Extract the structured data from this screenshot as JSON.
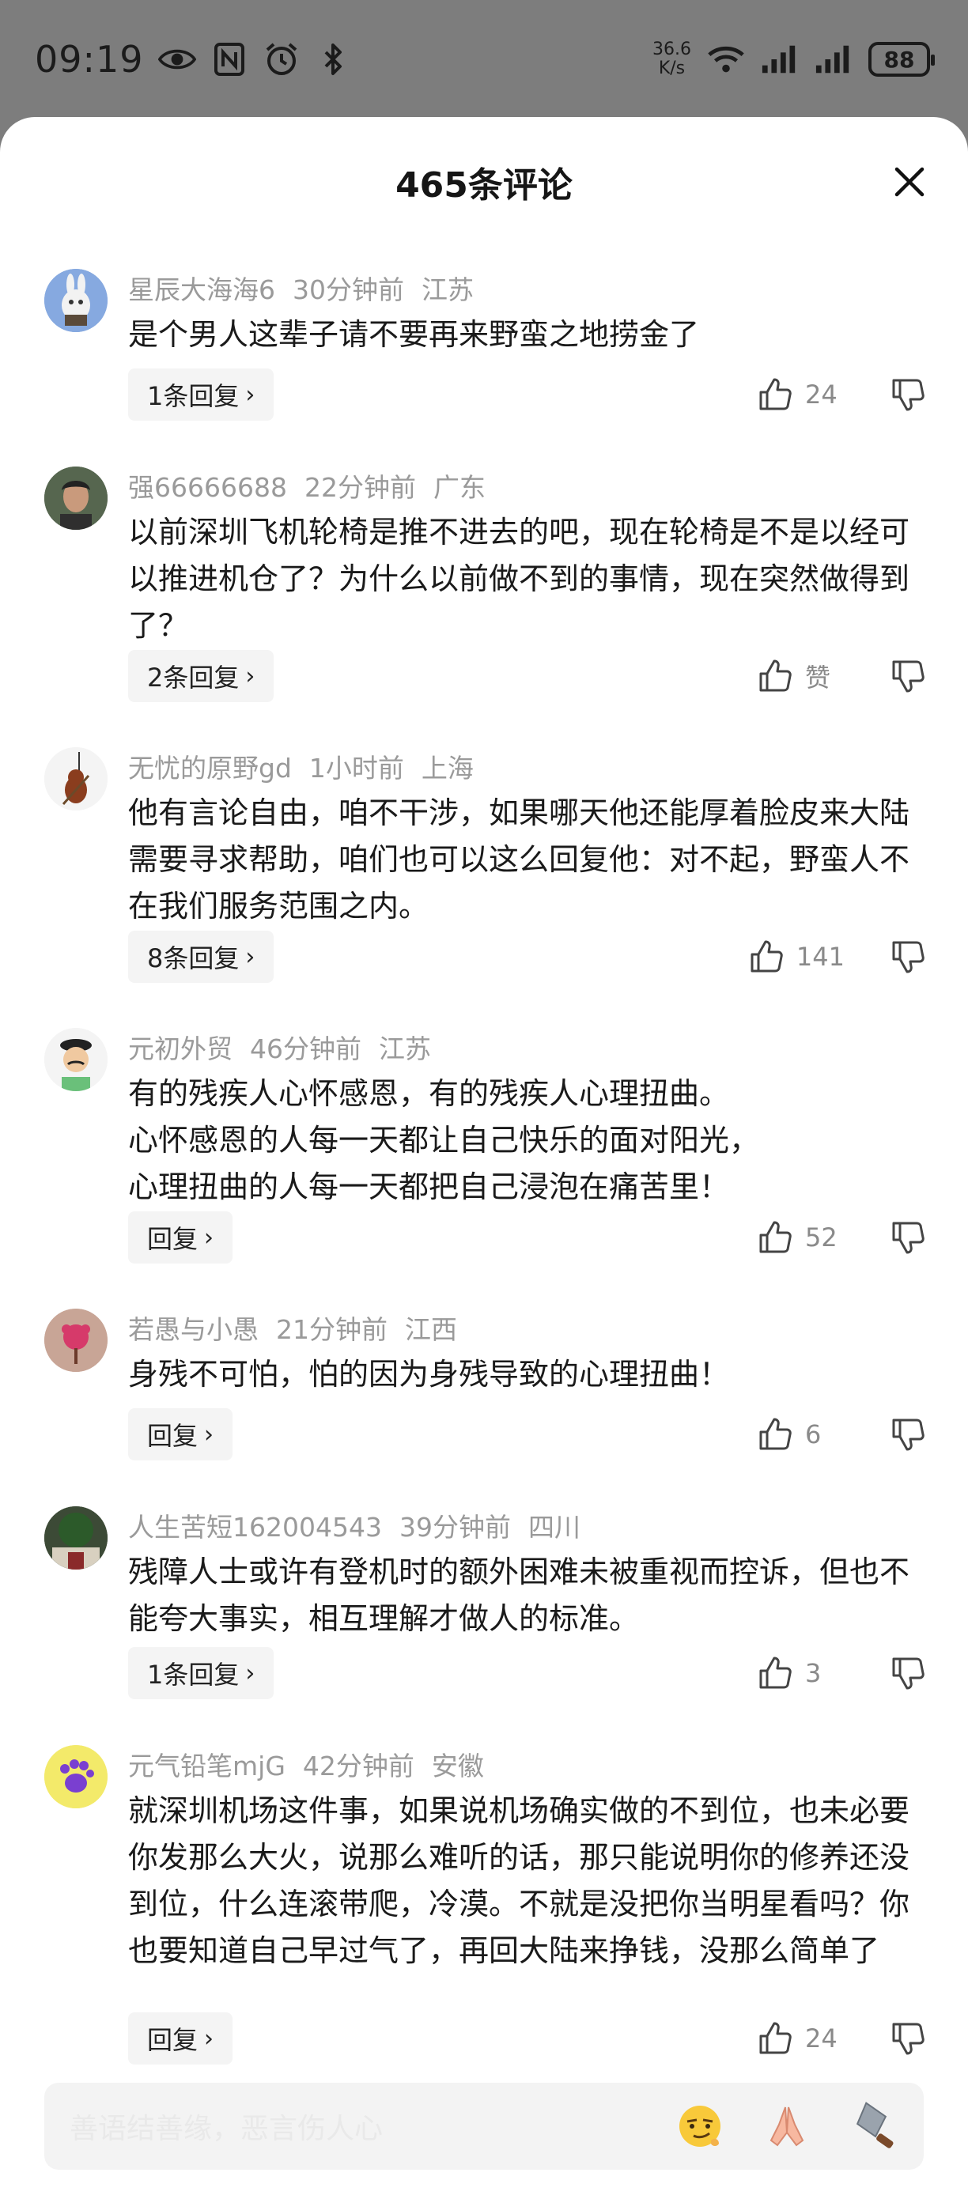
{
  "status_bar": {
    "time": "09:19",
    "speed_value": "36.6",
    "speed_unit": "K/s",
    "battery": "88"
  },
  "sheet": {
    "title": "465条评论"
  },
  "comments": [
    {
      "user": "星辰大海海6",
      "time": "30分钟前",
      "location": "江苏",
      "text": [
        "是个男人这辈子请不要再来野蛮之地捞金了"
      ],
      "reply_label": "1条回复",
      "likes": "24"
    },
    {
      "user": "强66666688",
      "time": "22分钟前",
      "location": "广东",
      "text": [
        "以前深圳飞机轮椅是推不进去的吧，现在轮椅是不是以经可以推进机仓了？为什么以前做不到的事情，现在突然做得到了？"
      ],
      "reply_label": "2条回复",
      "likes": "赞"
    },
    {
      "user": "无忧的原野gd",
      "time": "1小时前",
      "location": "上海",
      "text": [
        "他有言论自由，咱不干涉，如果哪天他还能厚着脸皮来大陆需要寻求帮助，咱们也可以这么回复他：对不起，野蛮人不在我们服务范围之内。"
      ],
      "reply_label": "8条回复",
      "likes": "141"
    },
    {
      "user": "元初外贸",
      "time": "46分钟前",
      "location": "江苏",
      "text": [
        "有的残疾人心怀感恩，有的残疾人心理扭曲。",
        "心怀感恩的人每一天都让自己快乐的面对阳光，",
        "心理扭曲的人每一天都把自己浸泡在痛苦里！"
      ],
      "reply_label": "回复",
      "likes": "52"
    },
    {
      "user": "若愚与小愚",
      "time": "21分钟前",
      "location": "江西",
      "text": [
        "身残不可怕，怕的因为身残导致的心理扭曲！"
      ],
      "reply_label": "回复",
      "likes": "6"
    },
    {
      "user": "人生苦短162004543",
      "time": "39分钟前",
      "location": "四川",
      "text": [
        "残障人士或许有登机时的额外困难未被重视而控诉，但也不能夸大事实，相互理解才做人的标准。"
      ],
      "reply_label": "1条回复",
      "likes": "3"
    },
    {
      "user": "元气铅笔mjG",
      "time": "42分钟前",
      "location": "安徽",
      "text": [
        "就深圳机场这件事，如果说机场确实做的不到位，也未必要你发那么大火，说那么难听的话，那只能说明你的修养还没到位，什么连滚带爬，冷漠。不就是没把你当明星看吗？你也要知道自己早过气了，再回大陆来挣钱，没那么简单了"
      ],
      "reply_label": "回复",
      "likes": "24"
    }
  ],
  "input_bar": {
    "placeholder": "善语结善缘，恶言伤人心"
  }
}
